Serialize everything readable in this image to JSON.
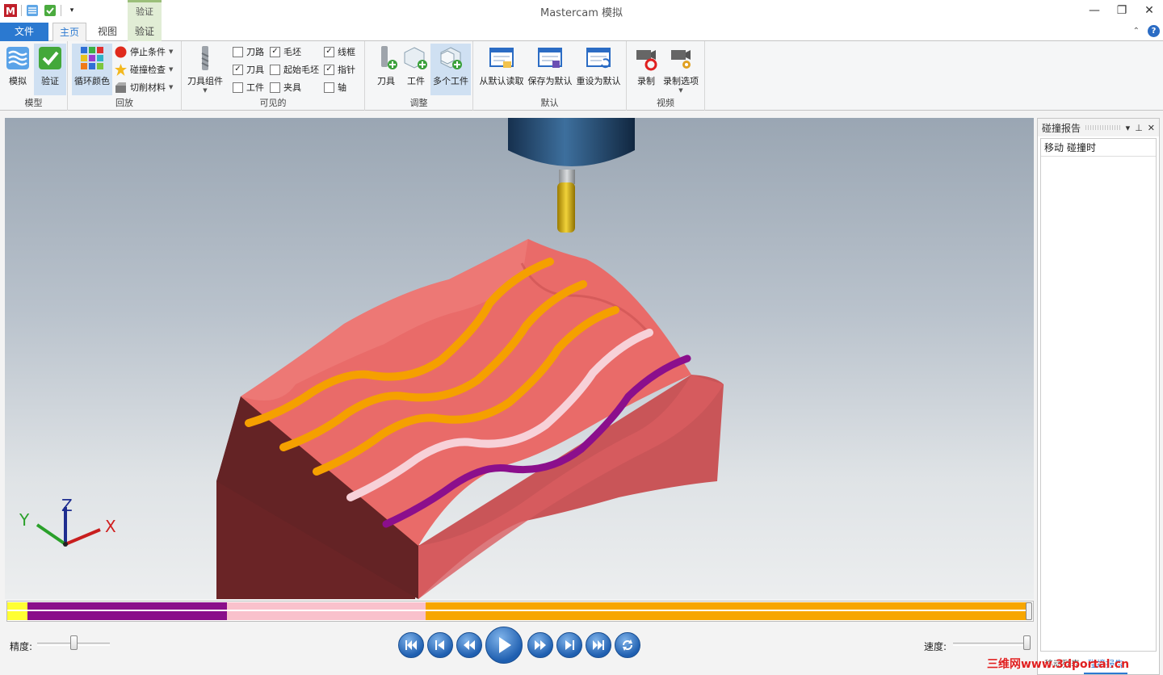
{
  "titlebar": {
    "title": "Mastercam 模拟",
    "context_tab": "验证",
    "window_buttons": [
      "minimize-icon",
      "restore-icon",
      "close-icon"
    ]
  },
  "tabs": {
    "file": "文件",
    "home": "主页",
    "view": "视图",
    "verify": "验证"
  },
  "ribbon": {
    "model": {
      "label": "模型",
      "simulate": "模拟",
      "verify": "验证"
    },
    "playback": {
      "label": "回放",
      "cycle_colors": "循环颜色",
      "stop_conditions": "停止条件",
      "collision_check": "碰撞检查",
      "cut_material": "切削材料"
    },
    "visible": {
      "label": "可见的",
      "tool_assembly": "刀具组件",
      "items": [
        {
          "label": "刀路",
          "checked": false
        },
        {
          "label": "刀具",
          "checked": true
        },
        {
          "label": "工件",
          "checked": false
        },
        {
          "label": "毛坯",
          "checked": true
        },
        {
          "label": "起始毛坯",
          "checked": false
        },
        {
          "label": "夹具",
          "checked": false
        },
        {
          "label": "线框",
          "checked": true
        },
        {
          "label": "指针",
          "checked": true
        },
        {
          "label": "轴",
          "checked": false
        }
      ]
    },
    "adjust": {
      "label": "调整",
      "tool": "刀具",
      "workpiece": "工件",
      "multi_workpiece": "多个工件"
    },
    "defaults": {
      "label": "默认",
      "read_default": "从默认读取",
      "save_default": "保存为默认",
      "reset_default": "重设为默认"
    },
    "video": {
      "label": "视频",
      "record": "录制",
      "record_options": "录制选项"
    }
  },
  "axes": {
    "x": "X",
    "y": "Y",
    "z": "Z"
  },
  "controls": {
    "precision_label": "精度:",
    "speed_label": "速度:",
    "precision_level": 0.5,
    "speed_level": 1.0,
    "buttons": [
      "skip-start-icon",
      "step-back-icon",
      "rewind-icon",
      "play-icon",
      "fast-forward-icon",
      "step-forward-icon",
      "skip-end-icon",
      "loop-icon"
    ]
  },
  "timeline": {
    "segments": [
      {
        "color": "#ffff33",
        "fraction": 0.02
      },
      {
        "color": "#8a0e8a",
        "fraction": 0.195
      },
      {
        "color": "#f9c1cc",
        "fraction": 0.195
      },
      {
        "color": "#f7a600",
        "fraction": 0.59
      }
    ]
  },
  "panel": {
    "title": "碰撞报告",
    "col_move": "移动",
    "col_collision": "碰撞时",
    "tab_move_list": "移动列表",
    "tab_collision_report": "碰撞报告"
  },
  "colors": {
    "stock": "#e86a68",
    "stock_dark": "#6a2426",
    "toolpath_orange": "#f5a000",
    "toolpath_pink": "#f7d1d8",
    "toolpath_purple": "#8b0f8c",
    "accent": "#2b79d0"
  },
  "watermark": "三维网www.3dportal.cn"
}
